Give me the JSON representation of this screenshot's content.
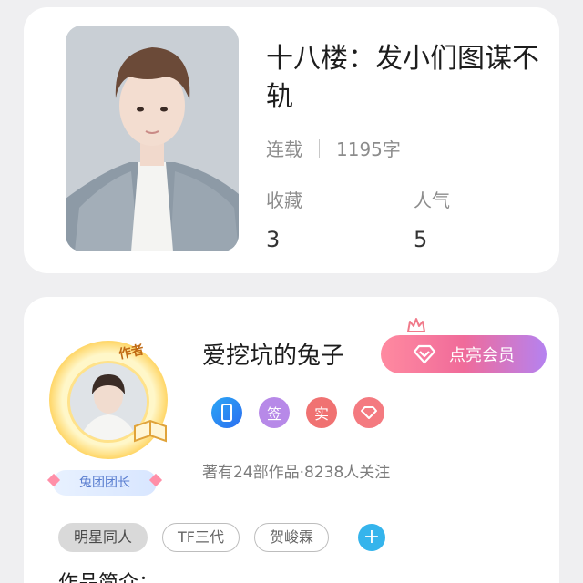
{
  "book": {
    "title": "十八楼：发小们图谋不轨",
    "status": "连载",
    "word_count": "1195字",
    "favorites_label": "收藏",
    "favorites_value": "3",
    "popularity_label": "人气",
    "popularity_value": "5"
  },
  "author": {
    "tag": "作者",
    "name": "爱挖坑的兔子",
    "leader_badge": "兔团团长",
    "vip_button": "点亮会员",
    "badges": [
      "签",
      "实"
    ],
    "works_info": "著有24部作品·8238人关注"
  },
  "tags": [
    "明星同人",
    "TF三代",
    "贺峻霖"
  ],
  "add_tag_symbol": "+",
  "intro_label": "作品简介",
  "colors": {
    "vip_gradient_start": "#ff8aa0",
    "vip_gradient_end": "#b582f0",
    "add_button": "#35b4ec",
    "badge_phone": "#2d6ef0",
    "badge_sign": "#b789e8",
    "badge_real": "#f07272"
  }
}
